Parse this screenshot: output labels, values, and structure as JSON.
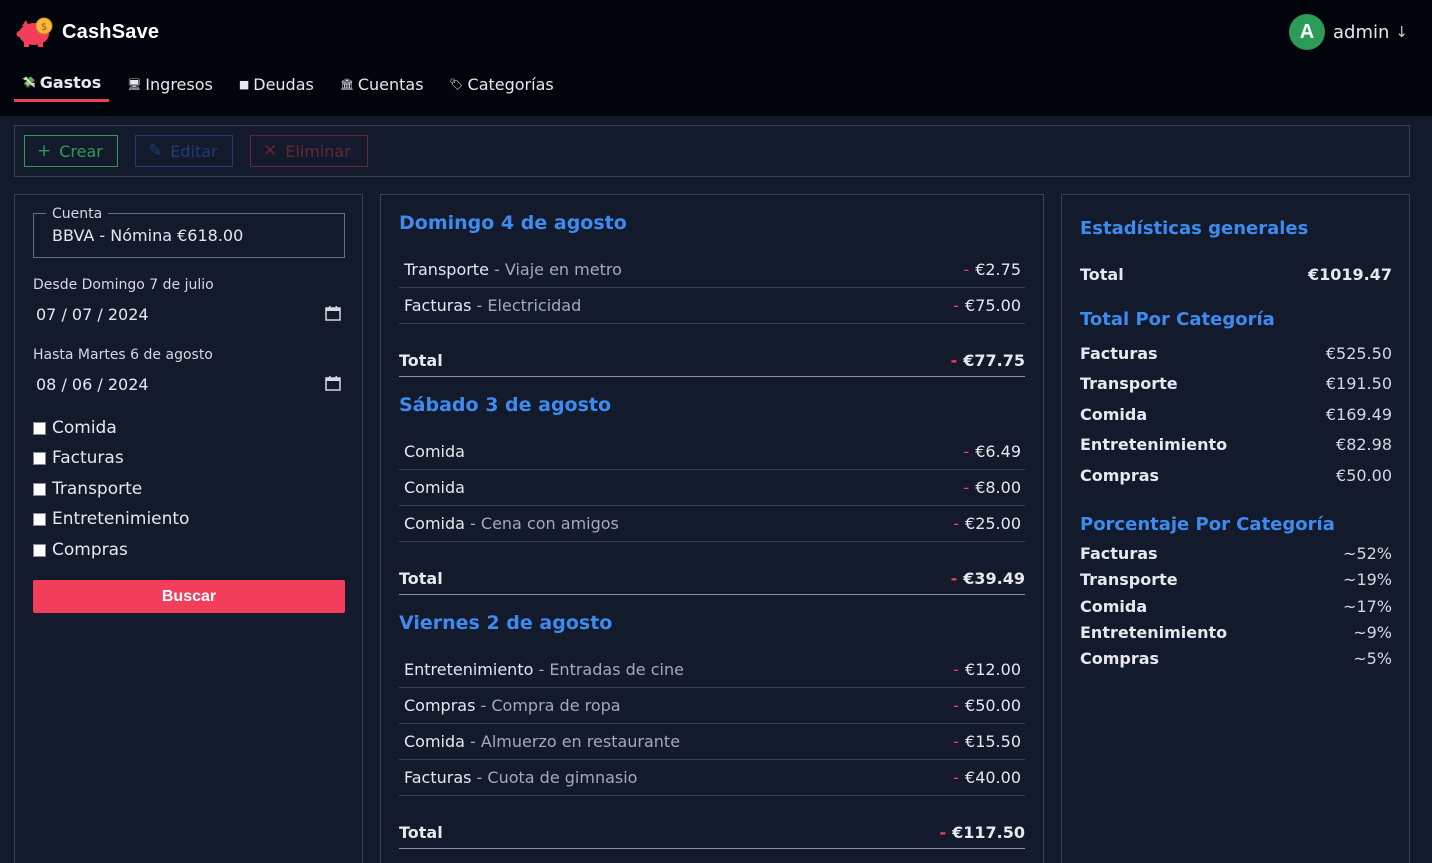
{
  "app": {
    "name": "CashSave"
  },
  "user": {
    "initial": "A",
    "name": "admin",
    "arrow": "↓"
  },
  "tabs": [
    {
      "label": "Gastos",
      "icon": "💸",
      "active": true
    },
    {
      "label": "Ingresos",
      "icon": "🖥",
      "active": false
    },
    {
      "label": "Deudas",
      "icon": "■",
      "active": false
    },
    {
      "label": "Cuentas",
      "icon": "🏛",
      "active": false
    },
    {
      "label": "Categorías",
      "icon": "🏷",
      "active": false
    }
  ],
  "toolbar": {
    "create": {
      "icon": "+",
      "label": "Crear"
    },
    "edit": {
      "icon": "✎",
      "label": "Editar"
    },
    "delete": {
      "icon": "✕",
      "label": "Eliminar"
    }
  },
  "filters": {
    "account_legend": "Cuenta",
    "account_value": "BBVA - Nómina €618.00",
    "from_label": "Desde Domingo 7 de julio",
    "from_value": "07 / 07 / 2024",
    "to_label": "Hasta Martes 6 de agosto",
    "to_value": "08 / 06 / 2024",
    "categories": [
      "Comida",
      "Facturas",
      "Transporte",
      "Entretenimiento",
      "Compras"
    ],
    "search_label": "Buscar"
  },
  "days": [
    {
      "title": "Domingo 4 de agosto",
      "items": [
        {
          "category": "Transporte",
          "desc": " - Viaje en metro",
          "amount": "€2.75"
        },
        {
          "category": "Facturas",
          "desc": " - Electricidad",
          "amount": "€75.00"
        }
      ],
      "total_label": "Total",
      "total": "€77.75"
    },
    {
      "title": "Sábado 3 de agosto",
      "items": [
        {
          "category": "Comida",
          "desc": "",
          "amount": "€6.49"
        },
        {
          "category": "Comida",
          "desc": "",
          "amount": "€8.00"
        },
        {
          "category": "Comida",
          "desc": " - Cena con amigos",
          "amount": "€25.00"
        }
      ],
      "total_label": "Total",
      "total": "€39.49"
    },
    {
      "title": "Viernes 2 de agosto",
      "items": [
        {
          "category": "Entretenimiento",
          "desc": " - Entradas de cine",
          "amount": "€12.00"
        },
        {
          "category": "Compras",
          "desc": " - Compra de ropa",
          "amount": "€50.00"
        },
        {
          "category": "Comida",
          "desc": " - Almuerzo en restaurante",
          "amount": "€15.50"
        },
        {
          "category": "Facturas",
          "desc": " - Cuota de gimnasio",
          "amount": "€40.00"
        }
      ],
      "total_label": "Total",
      "total": "€117.50"
    }
  ],
  "minus_sign": "-",
  "stats": {
    "general_title": "Estadísticas generales",
    "total_label": "Total",
    "total_value": "€1019.47",
    "by_category_title": "Total Por Categoría",
    "by_category": [
      {
        "label": "Facturas",
        "value": "€525.50"
      },
      {
        "label": "Transporte",
        "value": "€191.50"
      },
      {
        "label": "Comida",
        "value": "€169.49"
      },
      {
        "label": "Entretenimiento",
        "value": "€82.98"
      },
      {
        "label": "Compras",
        "value": "€50.00"
      }
    ],
    "percent_title": "Porcentaje Por Categoría",
    "percent": [
      {
        "label": "Facturas",
        "value": "~52%"
      },
      {
        "label": "Transporte",
        "value": "~19%"
      },
      {
        "label": "Comida",
        "value": "~17%"
      },
      {
        "label": "Entretenimiento",
        "value": "~9%"
      },
      {
        "label": "Compras",
        "value": "~5%"
      }
    ]
  },
  "colors": {
    "accent": "#f33e5b",
    "link": "#3e8bf0",
    "success": "#2f9a55",
    "header": "#02050c",
    "background": "#131a2b"
  }
}
